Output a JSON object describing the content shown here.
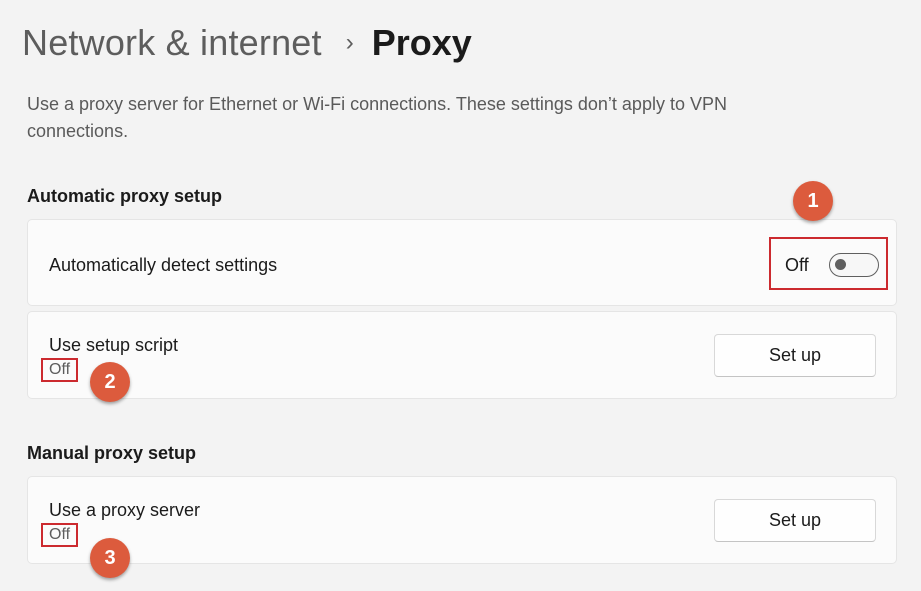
{
  "breadcrumb": {
    "parent": "Network & internet",
    "separator": "›",
    "current": "Proxy"
  },
  "description": "Use a proxy server for Ethernet or Wi-Fi connections. These settings don’t apply to VPN connections.",
  "automatic": {
    "heading": "Automatic proxy setup",
    "detect": {
      "title": "Automatically detect settings",
      "toggle_label": "Off",
      "toggle_on": false
    },
    "script": {
      "title": "Use setup script",
      "status": "Off",
      "button_label": "Set up"
    }
  },
  "manual": {
    "heading": "Manual proxy setup",
    "proxy": {
      "title": "Use a proxy server",
      "status": "Off",
      "button_label": "Set up"
    }
  },
  "annotations": {
    "marker1": "1",
    "marker2": "2",
    "marker3": "3",
    "marker_color": "#dc5b3d",
    "highlight_color": "#cc2a2f"
  }
}
